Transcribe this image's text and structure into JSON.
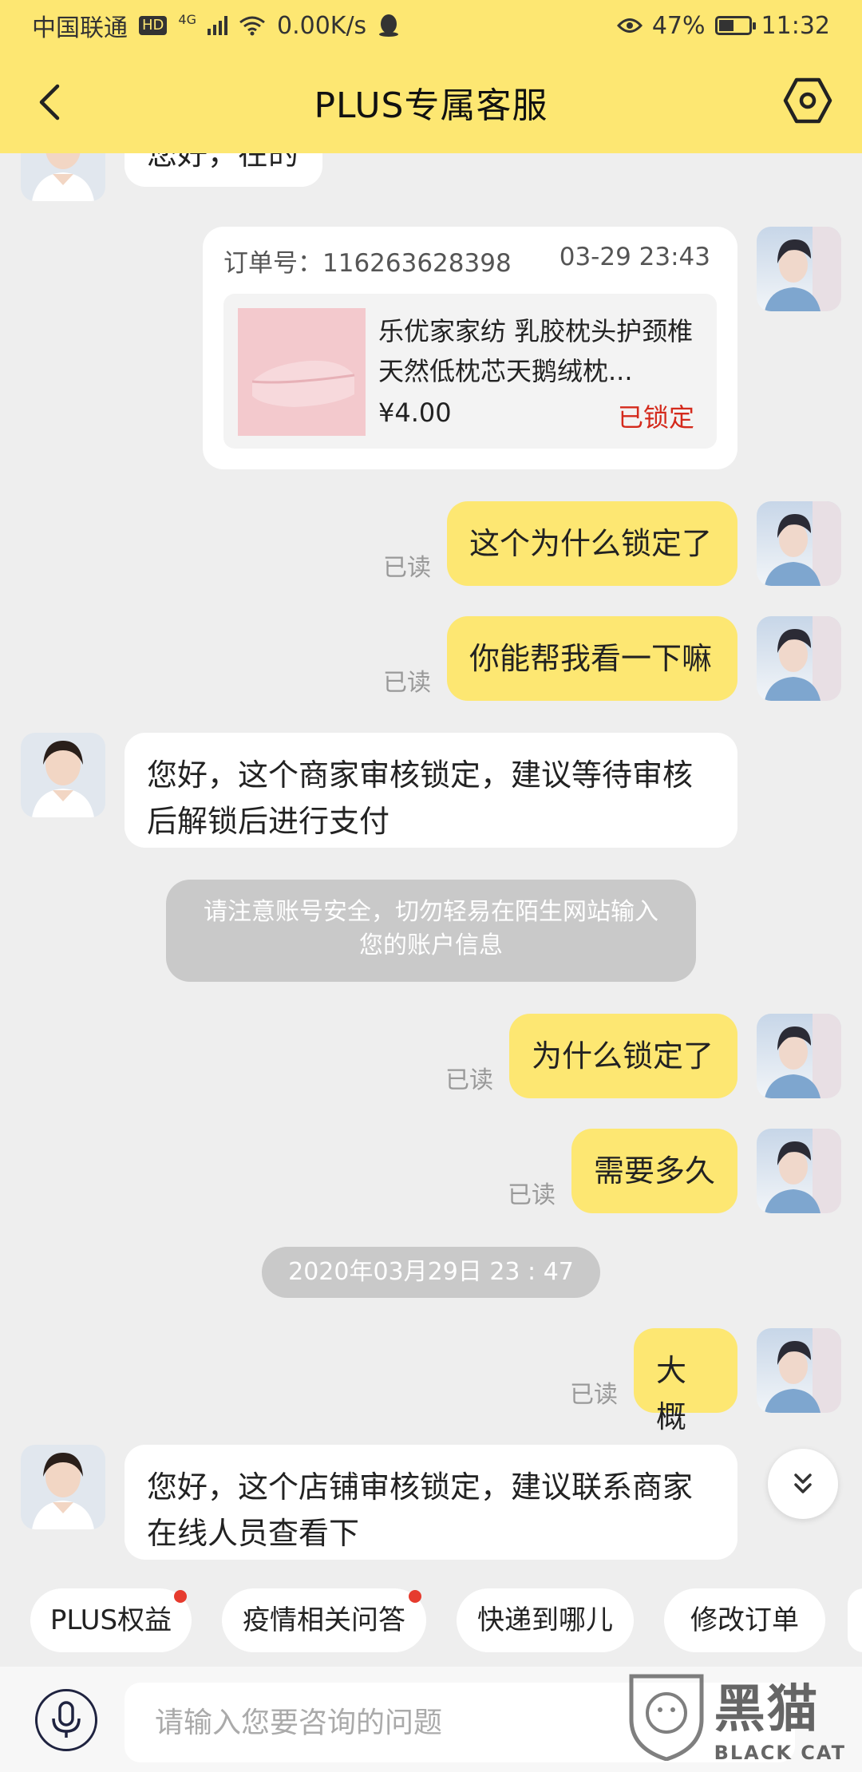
{
  "status_bar": {
    "carrier": "中国联通",
    "hd": "HD",
    "network": "4G",
    "speed": "0.00K/s",
    "battery": "47%",
    "battery_level": 0.47,
    "time": "11:32"
  },
  "header": {
    "title": "PLUS专属客服"
  },
  "messages": {
    "agent_1": "您好，在的",
    "order": {
      "label": "订单号：116263628398",
      "datetime": "03-29 23:43",
      "name": "乐优家家纺  乳胶枕头护颈椎天然低枕芯天鹅绒枕...",
      "price": "¥4.00",
      "status": "已锁定"
    },
    "user_1": "这个为什么锁定了",
    "user_2": "你能帮我看一下嘛",
    "agent_2": "您好，这个商家审核锁定，建议等待审核后解锁后进行支付",
    "notice": "请注意账号安全，切勿轻易在陌生网站输入您的账户信息",
    "user_3": "为什么锁定了",
    "user_4": "需要多久",
    "timestamp": "2020年03月29日  23 : 47",
    "user_5": "大概",
    "agent_3": "您好，这个店铺审核锁定，建议联系商家在线人员查看下",
    "read_label": "已读"
  },
  "chips": [
    "PLUS权益",
    "疫情相关问答",
    "快递到哪儿",
    "修改订单"
  ],
  "input": {
    "placeholder": "请输入您要咨询的问题"
  },
  "watermark": {
    "text_big": "黑猫",
    "text_small": "BLACK CAT"
  },
  "colors": {
    "accent": "#fde772",
    "background": "#eeeeee",
    "locked": "#d42a1c"
  }
}
